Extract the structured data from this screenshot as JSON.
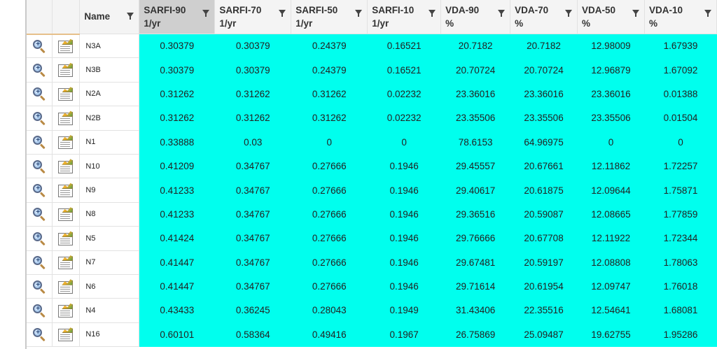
{
  "columns": {
    "name": "Name",
    "metrics": [
      {
        "label": "SARFI-90",
        "unit": "1/yr"
      },
      {
        "label": "SARFI-70",
        "unit": "1/yr"
      },
      {
        "label": "SARFI-50",
        "unit": "1/yr"
      },
      {
        "label": "SARFI-10",
        "unit": "1/yr"
      },
      {
        "label": "VDA-90",
        "unit": "%"
      },
      {
        "label": "VDA-70",
        "unit": "%"
      },
      {
        "label": "VDA-50",
        "unit": "%"
      },
      {
        "label": "VDA-10",
        "unit": "%"
      }
    ]
  },
  "icons": {
    "zoom": "magnifier-zoom-icon",
    "report": "report-chart-icon",
    "filter": "filter-funnel-icon"
  },
  "colors": {
    "value_cell_bg": "#00ffee",
    "sorted_header_bg": "#cfcfcf"
  },
  "rows": [
    {
      "name": "N3A",
      "values": [
        "0.30379",
        "0.30379",
        "0.24379",
        "0.16521",
        "20.7182",
        "20.7182",
        "12.98009",
        "1.67939"
      ]
    },
    {
      "name": "N3B",
      "values": [
        "0.30379",
        "0.30379",
        "0.24379",
        "0.16521",
        "20.70724",
        "20.70724",
        "12.96879",
        "1.67092"
      ]
    },
    {
      "name": "N2A",
      "values": [
        "0.31262",
        "0.31262",
        "0.31262",
        "0.02232",
        "23.36016",
        "23.36016",
        "23.36016",
        "0.01388"
      ]
    },
    {
      "name": "N2B",
      "values": [
        "0.31262",
        "0.31262",
        "0.31262",
        "0.02232",
        "23.35506",
        "23.35506",
        "23.35506",
        "0.01504"
      ]
    },
    {
      "name": "N1",
      "values": [
        "0.33888",
        "0.03",
        "0",
        "0",
        "78.6153",
        "64.96975",
        "0",
        "0"
      ]
    },
    {
      "name": "N10",
      "values": [
        "0.41209",
        "0.34767",
        "0.27666",
        "0.1946",
        "29.45557",
        "20.67661",
        "12.11862",
        "1.72257"
      ]
    },
    {
      "name": "N9",
      "values": [
        "0.41233",
        "0.34767",
        "0.27666",
        "0.1946",
        "29.40617",
        "20.61875",
        "12.09644",
        "1.75871"
      ]
    },
    {
      "name": "N8",
      "values": [
        "0.41233",
        "0.34767",
        "0.27666",
        "0.1946",
        "29.36516",
        "20.59087",
        "12.08665",
        "1.77859"
      ]
    },
    {
      "name": "N5",
      "values": [
        "0.41424",
        "0.34767",
        "0.27666",
        "0.1946",
        "29.76666",
        "20.67708",
        "12.11922",
        "1.72344"
      ]
    },
    {
      "name": "N7",
      "values": [
        "0.41447",
        "0.34767",
        "0.27666",
        "0.1946",
        "29.67481",
        "20.59197",
        "12.08808",
        "1.78063"
      ]
    },
    {
      "name": "N6",
      "values": [
        "0.41447",
        "0.34767",
        "0.27666",
        "0.1946",
        "29.71614",
        "20.61954",
        "12.09747",
        "1.76018"
      ]
    },
    {
      "name": "N4",
      "values": [
        "0.43433",
        "0.36245",
        "0.28043",
        "0.1949",
        "31.43406",
        "22.35516",
        "12.54641",
        "1.68081"
      ]
    },
    {
      "name": "N16",
      "values": [
        "0.60101",
        "0.58364",
        "0.49416",
        "0.1967",
        "26.75869",
        "25.09487",
        "19.62755",
        "1.95286"
      ]
    }
  ]
}
